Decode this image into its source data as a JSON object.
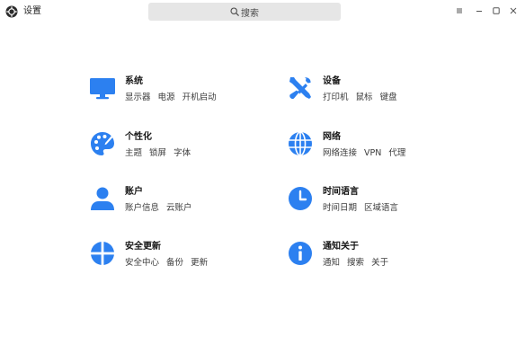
{
  "window": {
    "title": "设置",
    "search_placeholder": "搜索"
  },
  "accent_color": "#2c80f0",
  "categories": [
    {
      "title": "系统",
      "icon": "monitor-icon",
      "subs": [
        "显示器",
        "电源",
        "开机启动"
      ]
    },
    {
      "title": "设备",
      "icon": "tools-icon",
      "subs": [
        "打印机",
        "鼠标",
        "键盘"
      ]
    },
    {
      "title": "个性化",
      "icon": "palette-icon",
      "subs": [
        "主题",
        "锁屏",
        "字体"
      ]
    },
    {
      "title": "网络",
      "icon": "globe-icon",
      "subs": [
        "网络连接",
        "VPN",
        "代理"
      ]
    },
    {
      "title": "账户",
      "icon": "user-icon",
      "subs": [
        "账户信息",
        "云账户"
      ]
    },
    {
      "title": "时间语言",
      "icon": "clock-icon",
      "subs": [
        "时间日期",
        "区域语言"
      ]
    },
    {
      "title": "安全更新",
      "icon": "shield-cross-icon",
      "subs": [
        "安全中心",
        "备份",
        "更新"
      ]
    },
    {
      "title": "通知关于",
      "icon": "info-icon",
      "subs": [
        "通知",
        "搜索",
        "关于"
      ]
    }
  ]
}
